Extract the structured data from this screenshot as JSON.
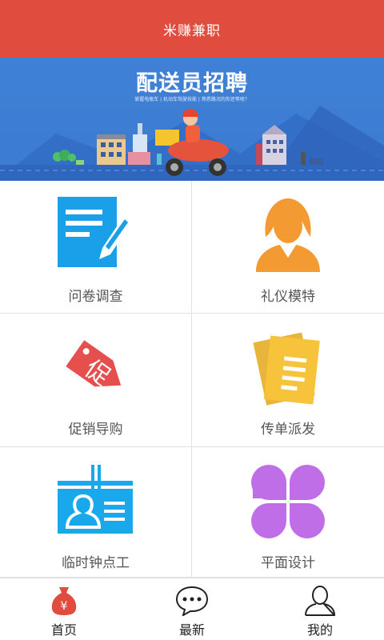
{
  "app_bar": {
    "title": "米赚兼职"
  },
  "banner": {
    "title": "配送员招聘",
    "subtitle": "掌握电瓶车 | 机动车驾驶技能 | 熟悉路况的你还等啥？"
  },
  "grid": {
    "items": [
      {
        "label": "问卷调查",
        "icon": "survey-icon",
        "color": "#1aa0e8"
      },
      {
        "label": "礼仪模特",
        "icon": "model-icon",
        "color": "#f39a32"
      },
      {
        "label": "促销导购",
        "icon": "promo-tag-icon",
        "color": "#e5504f",
        "icon_text": "促"
      },
      {
        "label": "传单派发",
        "icon": "flyer-icon",
        "color": "#f7c33b"
      },
      {
        "label": "临时钟点工",
        "icon": "id-badge-icon",
        "color": "#19a8ec"
      },
      {
        "label": "平面设计",
        "icon": "clover-icon",
        "color": "#c06ee8"
      }
    ]
  },
  "tab_bar": {
    "tabs": [
      {
        "label": "首页",
        "icon": "money-bag-icon",
        "active": true,
        "color": "#e04c3d",
        "icon_text": "¥"
      },
      {
        "label": "最新",
        "icon": "chat-bubble-icon",
        "active": false
      },
      {
        "label": "我的",
        "icon": "user-icon",
        "active": false
      }
    ]
  }
}
